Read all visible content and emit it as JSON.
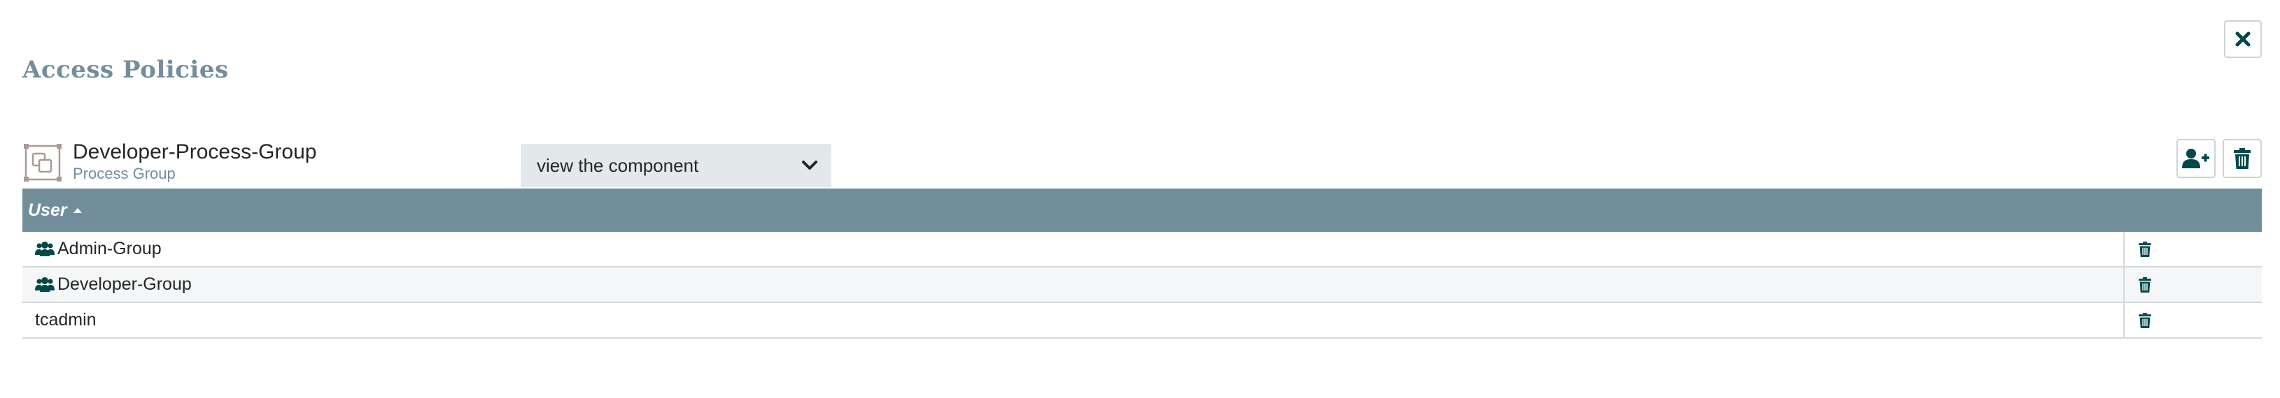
{
  "page": {
    "title": "Access Policies",
    "close_icon": "close-icon"
  },
  "component": {
    "name": "Developer-Process-Group",
    "type": "Process Group",
    "icon": "process-group-icon"
  },
  "policy_action": {
    "selected": "view the component",
    "icon": "chevron-down-icon"
  },
  "toolbar": {
    "add_user_icon": "add-user-icon",
    "delete_policy_icon": "trash-icon"
  },
  "table": {
    "columns": [
      {
        "label": "User",
        "sort": "ascending"
      },
      {
        "label": ""
      }
    ],
    "rows": [
      {
        "user": "Admin-Group",
        "kind": "group"
      },
      {
        "user": "Developer-Group",
        "kind": "group"
      },
      {
        "user": "tcadmin",
        "kind": "user"
      }
    ]
  },
  "colors": {
    "header_bg": "#728e9b",
    "title": "#728e9b",
    "icon_dark": "#004849"
  }
}
